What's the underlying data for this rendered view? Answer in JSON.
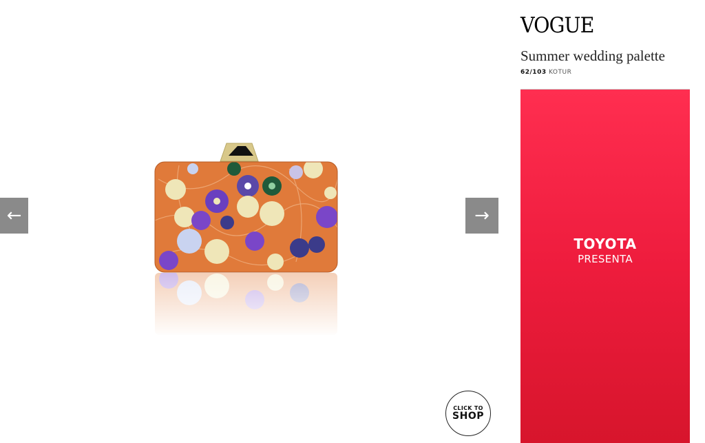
{
  "navigation": {
    "prev_icon": "arrow-left-icon",
    "prev_glyph": "←",
    "next_icon": "arrow-right-icon",
    "next_glyph": "→"
  },
  "shop_badge": {
    "line1": "CLICK TO",
    "line2": "SHOP"
  },
  "sidebar": {
    "logo": "VOGUE",
    "gallery_title": "Summer wedding palette",
    "counter": "62/103",
    "designer": "KOTUR"
  },
  "ad": {
    "brand": "TOYOTA",
    "subtitle": "PRESENTA",
    "color": "#ee1c3d"
  },
  "product": {
    "description": "floral-clutch-image",
    "colors": {
      "base": "#e07a3a",
      "violet": "#6a3fbf",
      "cream": "#efe6b8",
      "green": "#1f5a3a",
      "clasp": "#d8c88a"
    }
  }
}
